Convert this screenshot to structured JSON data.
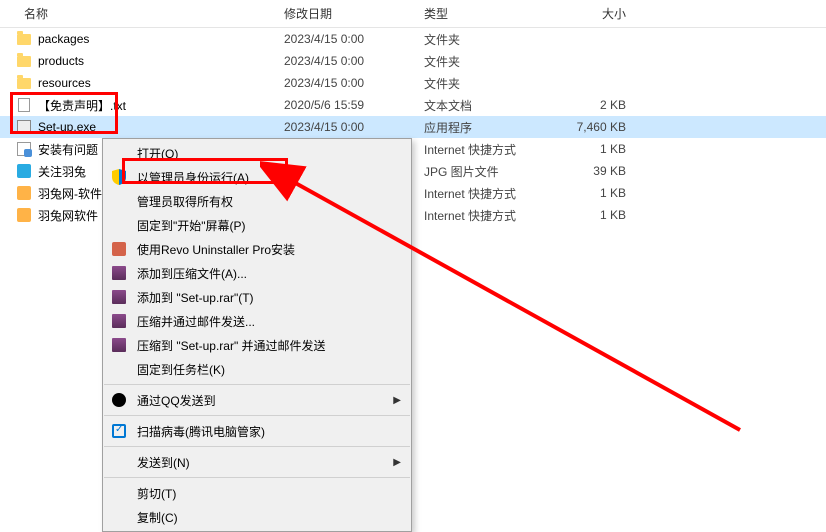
{
  "columns": {
    "name": "名称",
    "date": "修改日期",
    "type": "类型",
    "size": "大小"
  },
  "files": [
    {
      "name": "packages",
      "date": "2023/4/15 0:00",
      "type": "文件夹",
      "size": "",
      "icon": "folder"
    },
    {
      "name": "products",
      "date": "2023/4/15 0:00",
      "type": "文件夹",
      "size": "",
      "icon": "folder"
    },
    {
      "name": "resources",
      "date": "2023/4/15 0:00",
      "type": "文件夹",
      "size": "",
      "icon": "folder"
    },
    {
      "name": "【免责声明】.txt",
      "date": "2020/5/6 15:59",
      "type": "文本文档",
      "size": "2 KB",
      "icon": "txt"
    },
    {
      "name": "Set-up.exe",
      "date": "2023/4/15 0:00",
      "type": "应用程序",
      "size": "7,460 KB",
      "icon": "exe",
      "selected": true
    },
    {
      "name": "安装有问题",
      "date": "",
      "type": "Internet 快捷方式",
      "size": "1 KB",
      "icon": "url"
    },
    {
      "name": "关注羽兔",
      "date": "",
      "type": "JPG 图片文件",
      "size": "39 KB",
      "icon": "jpg"
    },
    {
      "name": "羽兔网-软件",
      "date": "",
      "type": "Internet 快捷方式",
      "size": "1 KB",
      "icon": "url2"
    },
    {
      "name": "羽兔网软件",
      "date": "",
      "type": "Internet 快捷方式",
      "size": "1 KB",
      "icon": "url2"
    }
  ],
  "menu": [
    {
      "label": "打开(O)",
      "icon": ""
    },
    {
      "label": "以管理员身份运行(A)",
      "icon": "shield",
      "highlight": true
    },
    {
      "label": "管理员取得所有权",
      "icon": ""
    },
    {
      "label": "固定到\"开始\"屏幕(P)",
      "icon": ""
    },
    {
      "label": "使用Revo Uninstaller Pro安装",
      "icon": "revo"
    },
    {
      "label": "添加到压缩文件(A)...",
      "icon": "rar"
    },
    {
      "label": "添加到 \"Set-up.rar\"(T)",
      "icon": "rar"
    },
    {
      "label": "压缩并通过邮件发送...",
      "icon": "rar"
    },
    {
      "label": "压缩到 \"Set-up.rar\" 并通过邮件发送",
      "icon": "rar"
    },
    {
      "label": "固定到任务栏(K)",
      "icon": ""
    },
    {
      "sep": true
    },
    {
      "label": "通过QQ发送到",
      "icon": "qq",
      "arrow": true
    },
    {
      "sep": true
    },
    {
      "label": "扫描病毒(腾讯电脑管家)",
      "icon": "scan"
    },
    {
      "sep": true
    },
    {
      "label": "发送到(N)",
      "icon": "",
      "arrow": true
    },
    {
      "sep": true
    },
    {
      "label": "剪切(T)",
      "icon": ""
    },
    {
      "label": "复制(C)",
      "icon": ""
    }
  ]
}
